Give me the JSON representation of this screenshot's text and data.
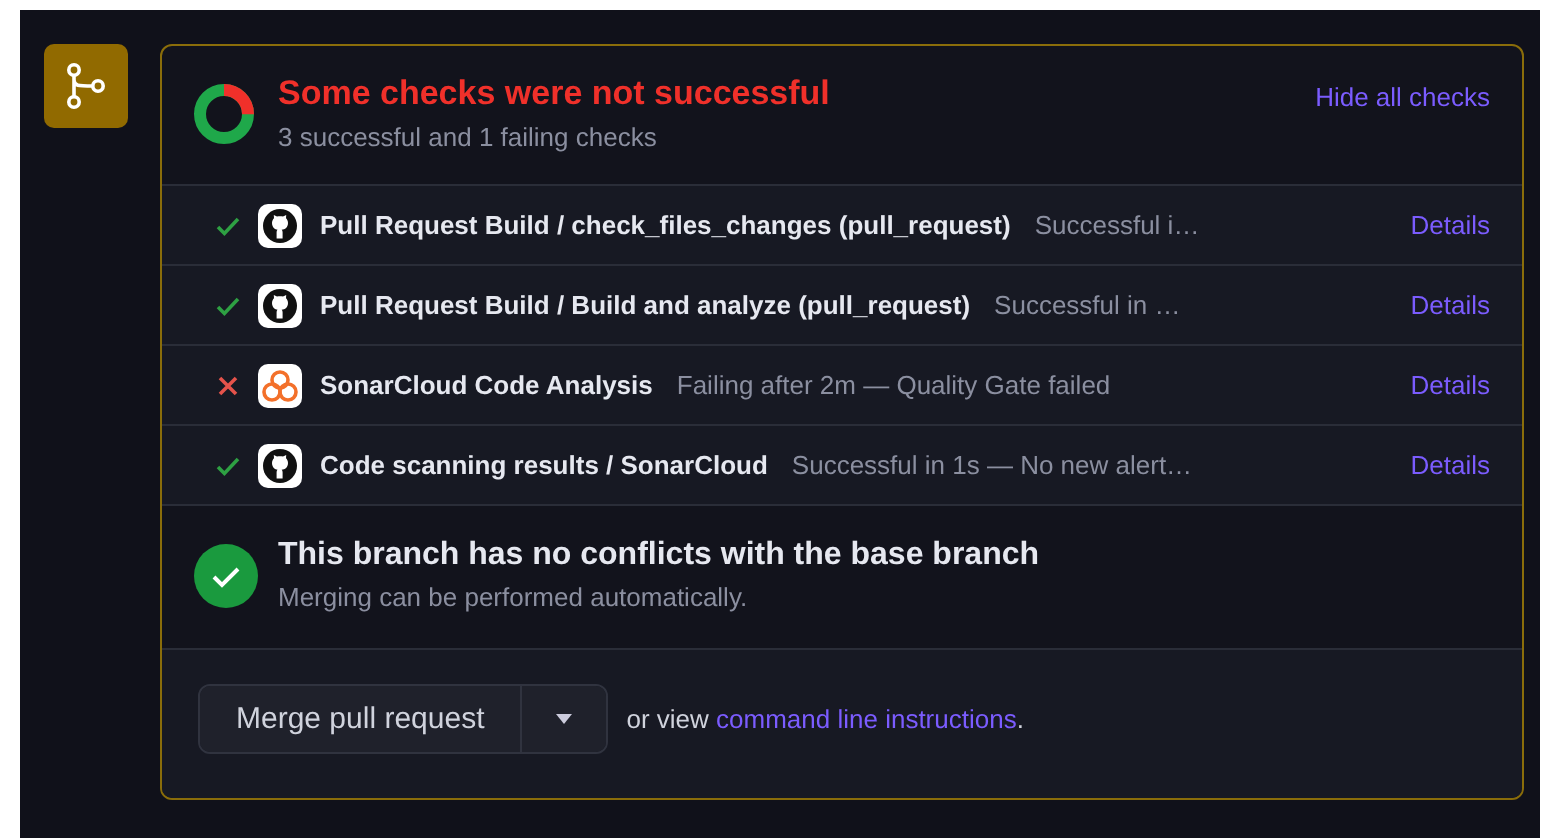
{
  "header": {
    "title": "Some checks were not successful",
    "subtitle": "3 successful and 1 failing checks",
    "toggle": "Hide all checks"
  },
  "checks": [
    {
      "kind": "success",
      "app": {
        "kind": "github"
      },
      "name": "Pull Request Build / check_files_changes (pull_request)",
      "description": "Successful i…",
      "link": "Details"
    },
    {
      "kind": "success",
      "app": {
        "kind": "github"
      },
      "name": "Pull Request Build / Build and analyze (pull_request)",
      "description": "Successful in …",
      "link": "Details"
    },
    {
      "kind": "failure",
      "app": {
        "kind": "sonarcloud"
      },
      "name": "SonarCloud Code Analysis",
      "description": "Failing after 2m — Quality Gate failed",
      "link": "Details"
    },
    {
      "kind": "success",
      "app": {
        "kind": "github"
      },
      "name": "Code scanning results / SonarCloud",
      "description": "Successful in 1s — No new alert…",
      "link": "Details"
    }
  ],
  "merge_status": {
    "title": "This branch has no conflicts with the base branch",
    "subtitle": "Merging can be performed automatically."
  },
  "merge": {
    "button": "Merge pull request",
    "prefix": "or view",
    "link": "command line instructions",
    "suffix": "."
  }
}
